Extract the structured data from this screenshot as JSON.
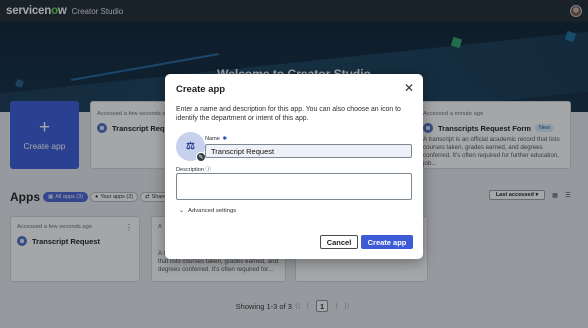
{
  "topnav": {
    "logo_prefix": "servicen",
    "logo_o": "o",
    "logo_suffix": "w",
    "app_name": "Creator Studio",
    "avatar_icon": "user-avatar"
  },
  "hero": {
    "title": "Welcome to Creator Studio"
  },
  "create_tile": {
    "plus": "+",
    "label": "Create app"
  },
  "recent": [
    {
      "meta": "Accessed a few seconds ago",
      "title": "Transcript Request",
      "description": ""
    },
    {
      "meta": "Accessed a minute ago",
      "title": "Transcripts Request Form",
      "badge": "New",
      "description": "A transcript is an official academic record that lists courses taken, grades earned, and degrees conferred. It's often required for further education, job..."
    }
  ],
  "apps": {
    "heading": "Apps",
    "filters": [
      {
        "icon": "grid-icon",
        "label": "All apps (3)"
      },
      {
        "icon": "person-icon",
        "label": "Your apps (3)"
      },
      {
        "icon": "share-icon",
        "label": "Shared"
      }
    ],
    "sort_label": "Last accessed ▾",
    "grid_view_icon": "▦",
    "list_view_icon": "☰",
    "cards": [
      {
        "meta": "Accessed a few seconds ago",
        "title": "Transcript Request",
        "kebab": "⋮",
        "description": ""
      },
      {
        "meta": "A",
        "title": "",
        "kebab": "",
        "description": "A transcript is an official academic record that lists courses taken, grades earned, and degrees conferred. It's often required for..."
      }
    ]
  },
  "pager": {
    "summary": "Showing 1-3 of 3",
    "first": "⟨⟨",
    "prev": "⟨",
    "page": "1",
    "next": "⟩",
    "last": "⟩⟩"
  },
  "modal": {
    "title": "Create app",
    "close": "✕",
    "description": "Enter a name and description for this app. You can also choose an icon to identify the department or intent of this app.",
    "icon_glyph": "⚖",
    "edit_glyph": "✎",
    "name_label": "Name",
    "required_mark": "✱",
    "name_value": "Transcript Request",
    "description_label": "Description",
    "info_glyph": "ⓘ",
    "description_value": "",
    "advanced_label": "Advanced settings",
    "chevron": "⌄",
    "cancel_label": "Cancel",
    "create_label": "Create app"
  },
  "colors": {
    "primary": "#3d5bd6",
    "nav": "#1f2a33",
    "logo_accent": "#62d84e"
  }
}
